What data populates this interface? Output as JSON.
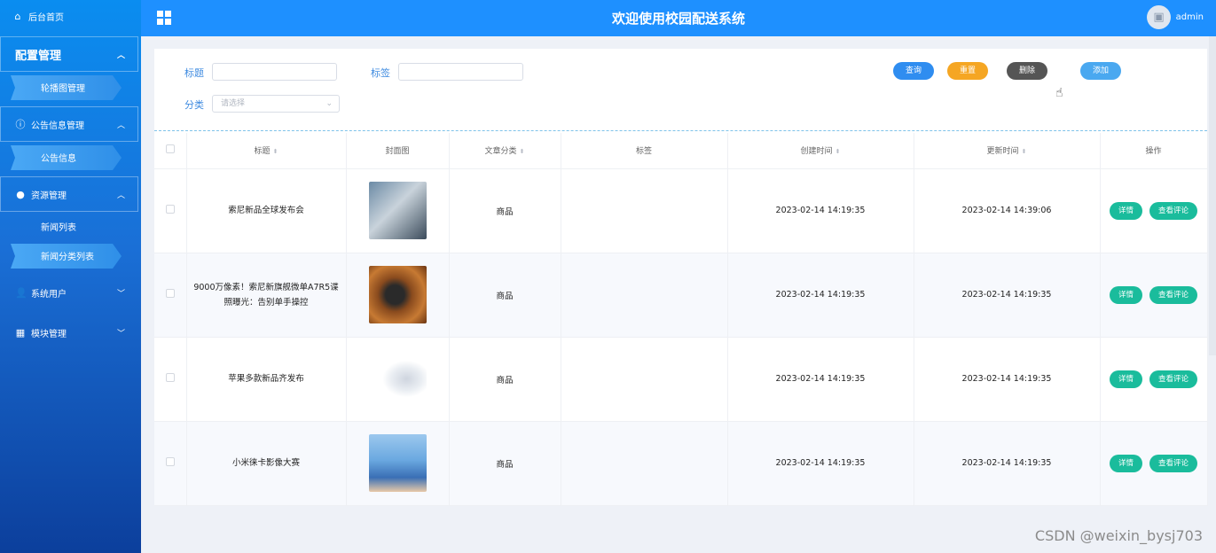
{
  "sidebar": {
    "home": "后台首页",
    "groups": [
      {
        "label": "配置管理",
        "children": [
          "轮播图管理"
        ]
      },
      {
        "label": "公告信息管理",
        "children": [
          "公告信息"
        ]
      },
      {
        "label": "资源管理",
        "children": [
          "新闻列表",
          "新闻分类列表"
        ]
      },
      {
        "label": "系统用户",
        "children": []
      },
      {
        "label": "模块管理",
        "children": []
      }
    ]
  },
  "header": {
    "title": "欢迎使用校园配送系统",
    "user": "admin"
  },
  "filters": {
    "title_label": "标题",
    "tag_label": "标签",
    "category_label": "分类",
    "category_placeholder": "请选择"
  },
  "buttons": {
    "query": "查询",
    "reset": "重置",
    "delete": "删除",
    "add": "添加"
  },
  "colors": {
    "header": "#1e90ff",
    "query": "#2f8df0",
    "reset": "#f5a623",
    "delete": "#555555",
    "add": "#4aa8f0",
    "action": "#1abc9c"
  },
  "table": {
    "columns": [
      "标题",
      "封面图",
      "文章分类",
      "标签",
      "创建时间",
      "更新时间",
      "操作"
    ],
    "rows": [
      {
        "title": "索尼新品全球发布会",
        "category": "商品",
        "tag": "",
        "created": "2023-02-14 14:19:35",
        "updated": "2023-02-14 14:39:06"
      },
      {
        "title": "9000万像素！索尼新旗舰微单A7R5谍照曝光：告别单手操控",
        "category": "商品",
        "tag": "",
        "created": "2023-02-14 14:19:35",
        "updated": "2023-02-14 14:19:35"
      },
      {
        "title": "苹果多款新品齐发布",
        "category": "商品",
        "tag": "",
        "created": "2023-02-14 14:19:35",
        "updated": "2023-02-14 14:19:35"
      },
      {
        "title": "小米徕卡影像大赛",
        "category": "商品",
        "tag": "",
        "created": "2023-02-14 14:19:35",
        "updated": "2023-02-14 14:19:35"
      }
    ],
    "action_detail": "详情",
    "action_comments": "查看评论"
  },
  "watermark": "CSDN @weixin_bysj703"
}
